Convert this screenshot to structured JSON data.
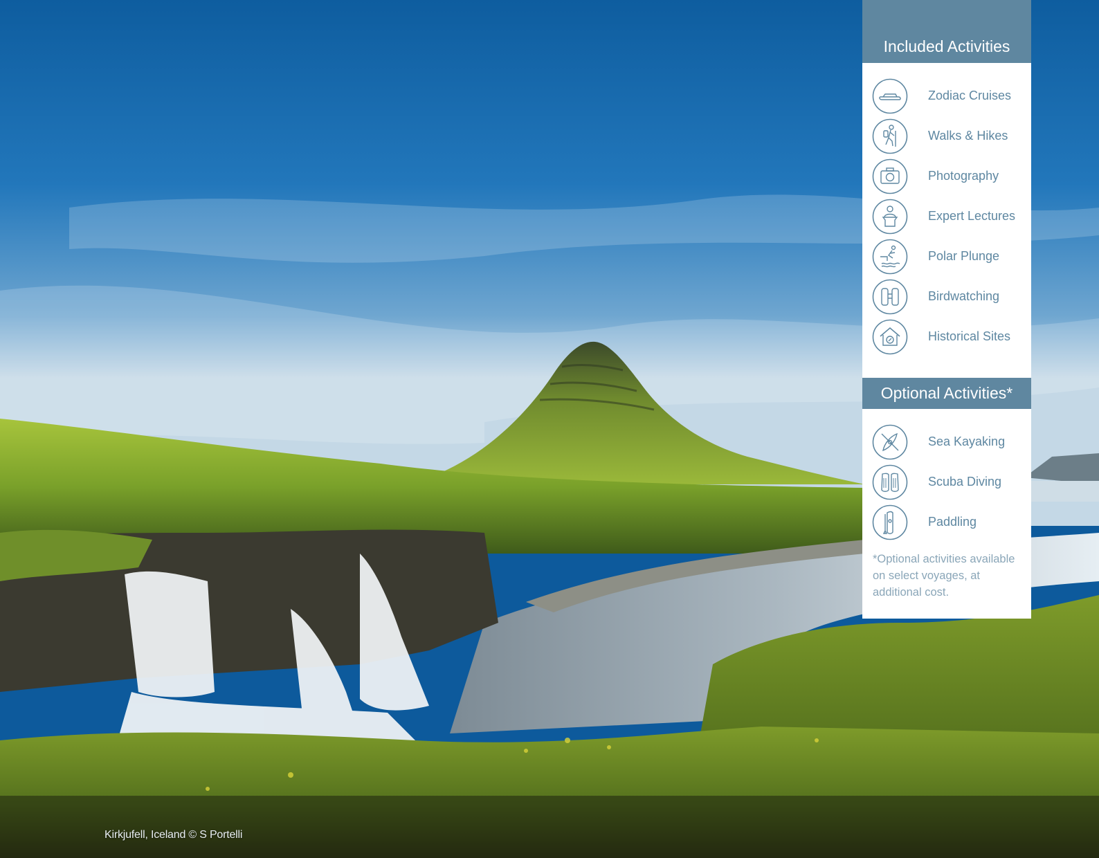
{
  "photo": {
    "caption": "Kirkjufell, Iceland © S Portelli"
  },
  "panel": {
    "included_title": "Included Activities",
    "included": [
      {
        "label": "Zodiac Cruises",
        "icon": "zodiac-boat-icon"
      },
      {
        "label": "Walks & Hikes",
        "icon": "hiker-icon"
      },
      {
        "label": "Photography",
        "icon": "camera-icon"
      },
      {
        "label": "Expert Lectures",
        "icon": "lecturer-icon"
      },
      {
        "label": "Polar Plunge",
        "icon": "polar-plunge-icon"
      },
      {
        "label": "Birdwatching",
        "icon": "binoculars-icon"
      },
      {
        "label": "Historical Sites",
        "icon": "historical-house-icon"
      }
    ],
    "optional_title": "Optional Activities*",
    "optional": [
      {
        "label": "Sea Kayaking",
        "icon": "kayak-icon"
      },
      {
        "label": "Scuba Diving",
        "icon": "scuba-fins-icon"
      },
      {
        "label": "Paddling",
        "icon": "paddleboard-icon"
      }
    ],
    "footnote": "*Optional activities available on select voyages, at additional cost."
  },
  "colors": {
    "panel_header": "#5f87a0",
    "text_blue": "#5e87a1",
    "footnote": "#8aa6b8",
    "sky": "#1c6fb5",
    "grass": "#8fb32a"
  }
}
